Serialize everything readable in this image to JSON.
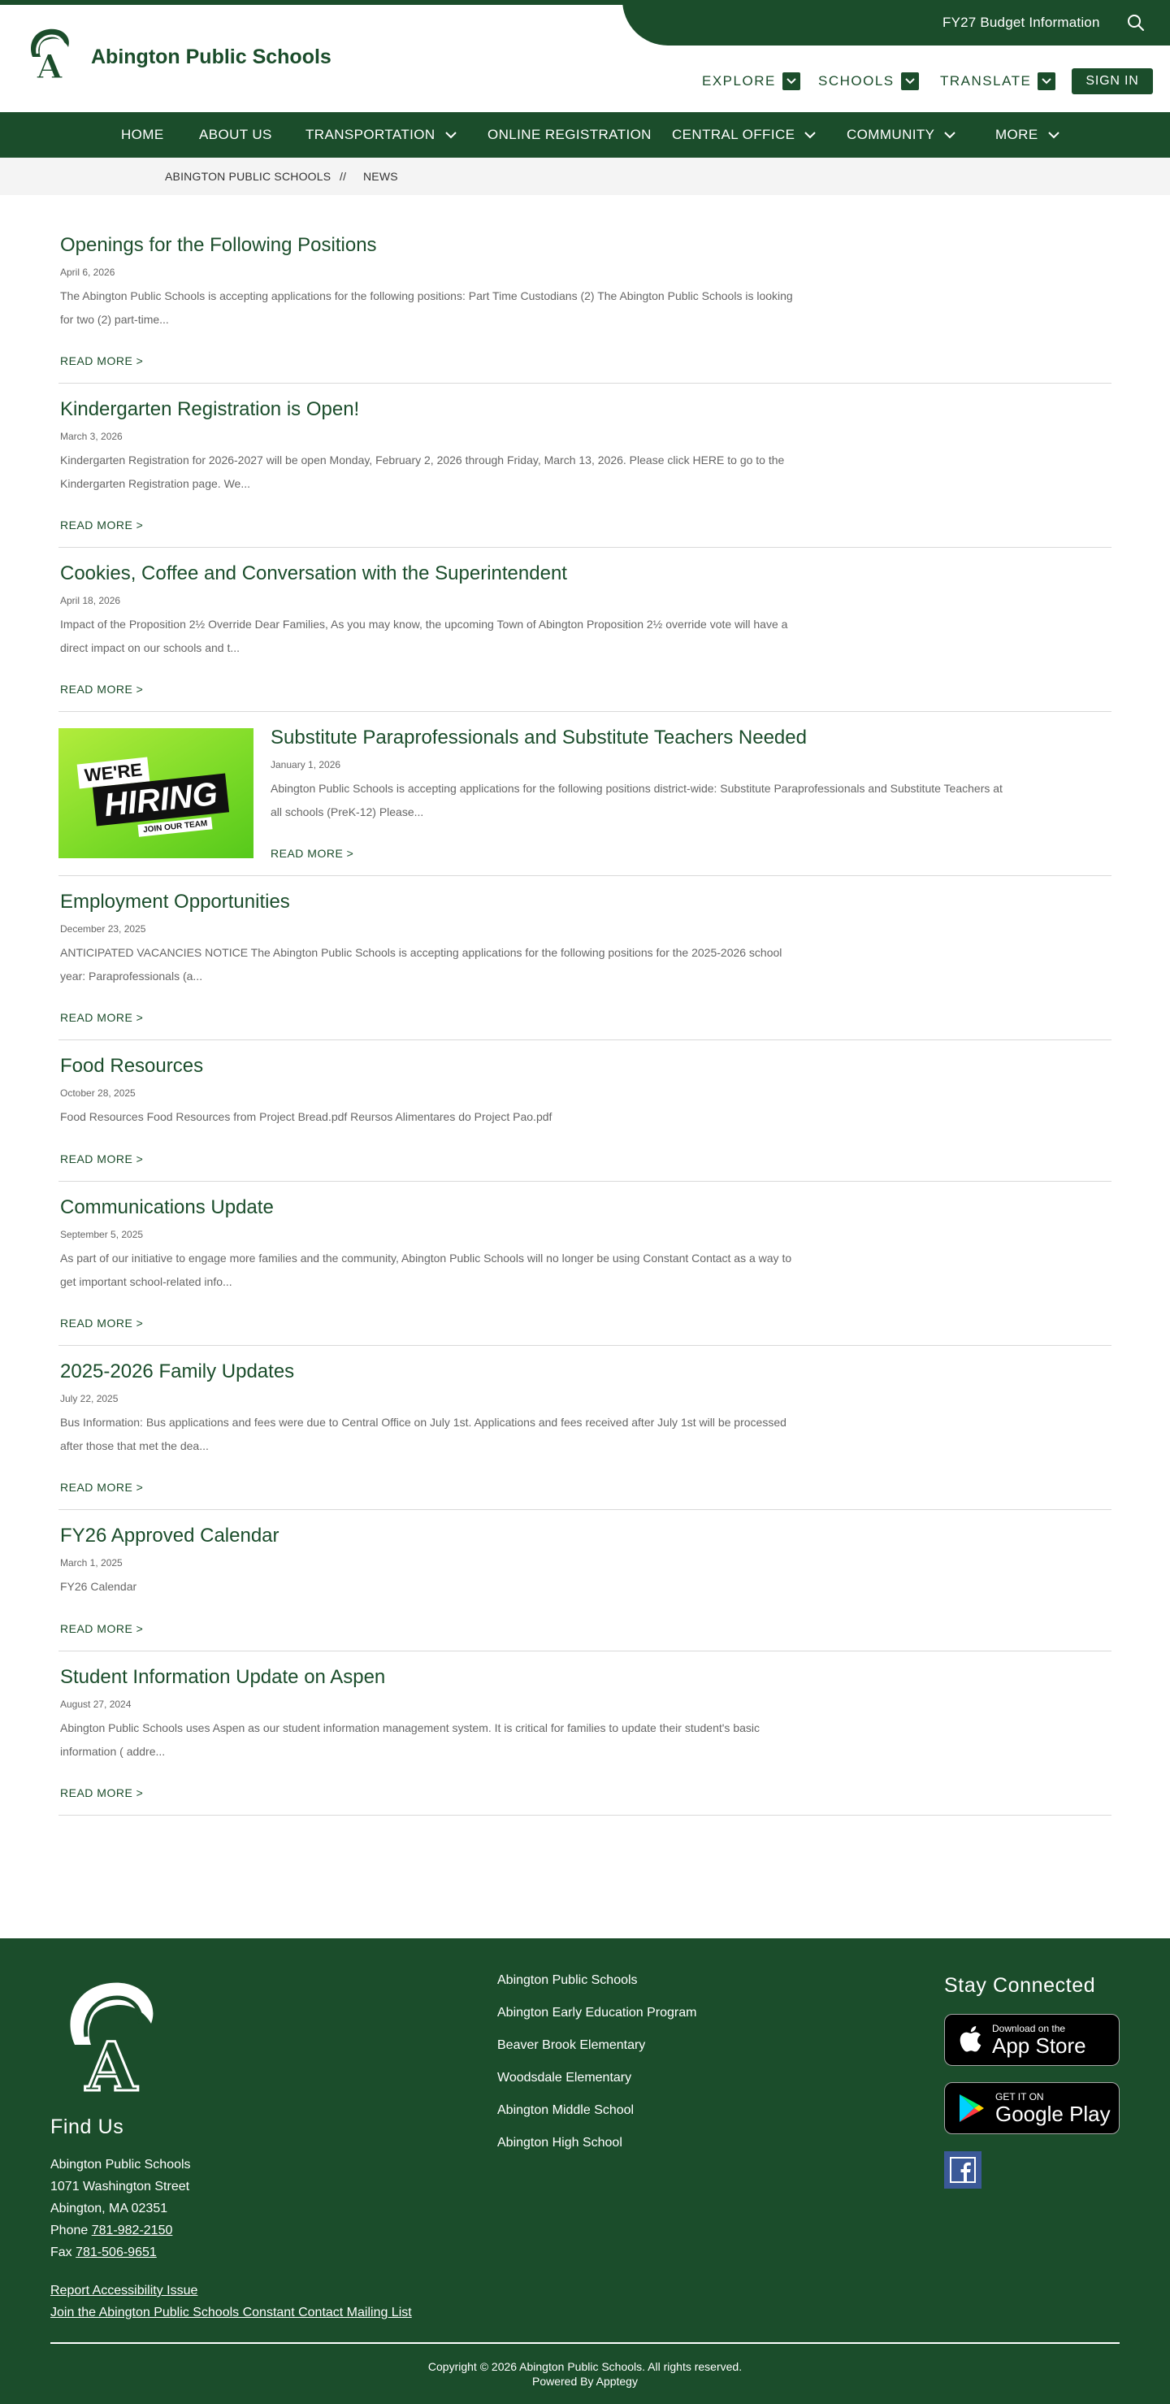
{
  "header": {
    "site_name": "Abington Public Schools",
    "budget_link": "FY27 Budget Information",
    "explore": "EXPLORE",
    "schools": "SCHOOLS",
    "translate": "TRANSLATE",
    "sign_in": "SIGN IN",
    "logo_letter": "A",
    "brand_color": "#1b4d2b",
    "search_icon": "search-icon"
  },
  "nav": {
    "items": [
      {
        "label": "HOME"
      },
      {
        "label": "ABOUT US"
      },
      {
        "label": "TRANSPORTATION"
      },
      {
        "label": "ONLINE REGISTRATION"
      },
      {
        "label": "CENTRAL OFFICE"
      },
      {
        "label": "COMMUNITY"
      },
      {
        "label": "MORE"
      }
    ]
  },
  "breadcrumb": {
    "home": "ABINGTON PUBLIC SCHOOLS",
    "separator": "//",
    "current": "NEWS"
  },
  "articles": [
    {
      "title": "Openings for the Following Positions",
      "date": "April 6, 2026",
      "summary_1": "The Abington Public Schools is accepting applications for the following positions: Part Time Custodians (2) The Abington Public Schools is looking",
      "summary_2": "for two (2) part-time...",
      "more": "READ MORE >"
    },
    {
      "title": "Kindergarten Registration is Open!",
      "date": "March 3, 2026",
      "summary_1": "Kindergarten Registration for 2026-2027 will be open Monday, February 2, 2026 through Friday, March 13, 2026. Please click HERE to go to the",
      "summary_2": "Kindergarten Registration page. We...",
      "more": "READ MORE >"
    },
    {
      "title": "Cookies, Coffee and Conversation with the Superintendent",
      "date": "April 18, 2026",
      "summary_1": "Impact of the Proposition 2½ Override Dear Families, As you may know, the upcoming Town of Abington Proposition 2½ override vote will have a",
      "summary_2": "direct impact on our schools and t...",
      "more": "READ MORE >"
    },
    {
      "title": "Substitute Paraprofessionals and Substitute Teachers Needed",
      "date": "January 1, 2026",
      "summary_1": "Abington Public Schools is accepting applications for the following positions district-wide: Substitute Paraprofessionals and Substitute Teachers at",
      "summary_2": "all schools (PreK-12) Please...",
      "more": "READ MORE >",
      "image": {
        "line1": "WE'RE",
        "line2": "HIRING",
        "line3": "JOIN OUR TEAM"
      }
    },
    {
      "title": "Employment Opportunities",
      "date": "December 23, 2025",
      "summary_1": "ANTICIPATED VACANCIES NOTICE The Abington Public Schools is accepting applications for the following positions for the 2025-2026 school",
      "summary_2": "year: Paraprofessionals (a...",
      "more": "READ MORE >"
    },
    {
      "title": "Food Resources",
      "date": "October 28, 2025",
      "summary_1": "Food Resources Food Resources from Project Bread.pdf  Reursos Alimentares do Project Pao.pdf",
      "more": "READ MORE >"
    },
    {
      "title": "Communications Update",
      "date": "September 5, 2025",
      "summary_1": "As part of our initiative to engage more families and the community, Abington Public Schools will no longer be using Constant Contact as a way to",
      "summary_2": "get important school-related info...",
      "more": "READ MORE >"
    },
    {
      "title": "2025-2026 Family Updates",
      "date": "July 22, 2025",
      "summary_1": "Bus Information: Bus applications and fees were due to Central Office on July 1st. Applications and fees received after July 1st will be processed",
      "summary_2": "after those that met the dea...",
      "more": "READ MORE >"
    },
    {
      "title": "FY26 Approved Calendar",
      "date": "March 1, 2025",
      "summary_1": "FY26 Calendar",
      "more": "READ MORE >"
    },
    {
      "title": "Student Information Update on Aspen",
      "date": "August 27, 2024",
      "summary_1": "Abington Public Schools uses Aspen as our student information management system. It is critical for families to update their student's basic",
      "summary_2": "information ( addre...",
      "more": "READ MORE >"
    }
  ],
  "footer": {
    "find_us": "Find Us",
    "name": "Abington Public Schools",
    "street": "1071 Washington Street",
    "city": "Abington, MA 02351",
    "phone_label": "Phone ",
    "phone": "781-982-2150",
    "fax_label": "Fax ",
    "fax": "781-506-9651",
    "accessibility": "Report Accessibility Issue",
    "mailing_list": "Join the Abington Public Schools Constant Contact Mailing List",
    "links": [
      {
        "label": "Abington Public Schools"
      },
      {
        "label": "Abington Early Education Program"
      },
      {
        "label": "Beaver Brook Elementary"
      },
      {
        "label": "Woodsdale Elementary"
      },
      {
        "label": "Abington Middle School"
      },
      {
        "label": "Abington High School"
      }
    ],
    "stay_connected": "Stay Connected",
    "app_store_small": "Download on the",
    "app_store_big": "App Store",
    "google_small": "GET IT ON",
    "google_big": "Google Play",
    "copyright": "Copyright © 2026 Abington Public Schools. All rights reserved.",
    "powered": "Powered By Apptegy"
  }
}
